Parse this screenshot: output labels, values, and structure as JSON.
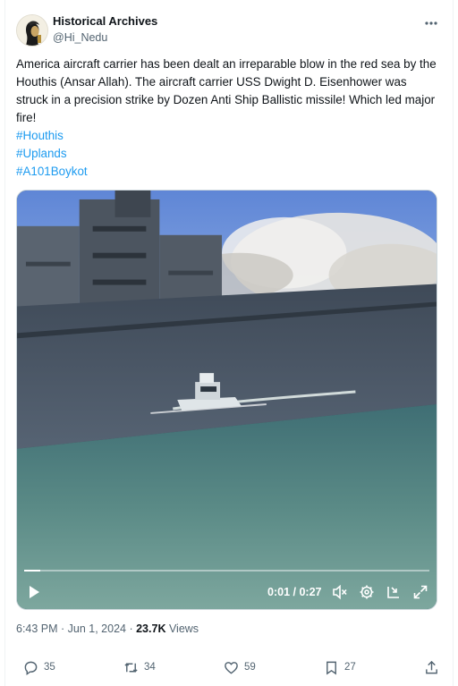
{
  "author": {
    "display_name": "Historical Archives",
    "handle": "@Hi_Nedu",
    "avatar_icon": "portrait-avatar-icon"
  },
  "tweet": {
    "text": "America aircraft carrier has been dealt an irreparable blow in the red sea by the Houthis (Ansar Allah). The aircraft carrier USS Dwight D. Eisenhower was struck in a precision strike by Dozen Anti Ship Ballistic missile! Which led major fire!",
    "hashtags": [
      "#Houthis",
      "#Uplands",
      "#A101Boykot"
    ]
  },
  "video": {
    "current_time": "0:01",
    "duration": "0:27",
    "time_separator": " / ",
    "progress": 0.04,
    "icons": [
      "play-icon",
      "mute-icon",
      "settings-icon",
      "minimize-icon",
      "fullscreen-icon"
    ]
  },
  "meta": {
    "timestamp": "6:43 PM · Jun 1, 2024 · ",
    "views_count": "23.7K",
    "views_label": " Views"
  },
  "actions": {
    "replies": "35",
    "reposts": "34",
    "likes": "59",
    "bookmarks": "27"
  },
  "colors": {
    "link": "#1d9bf0",
    "secondary_text": "#536471",
    "primary_text": "#0f1419"
  }
}
